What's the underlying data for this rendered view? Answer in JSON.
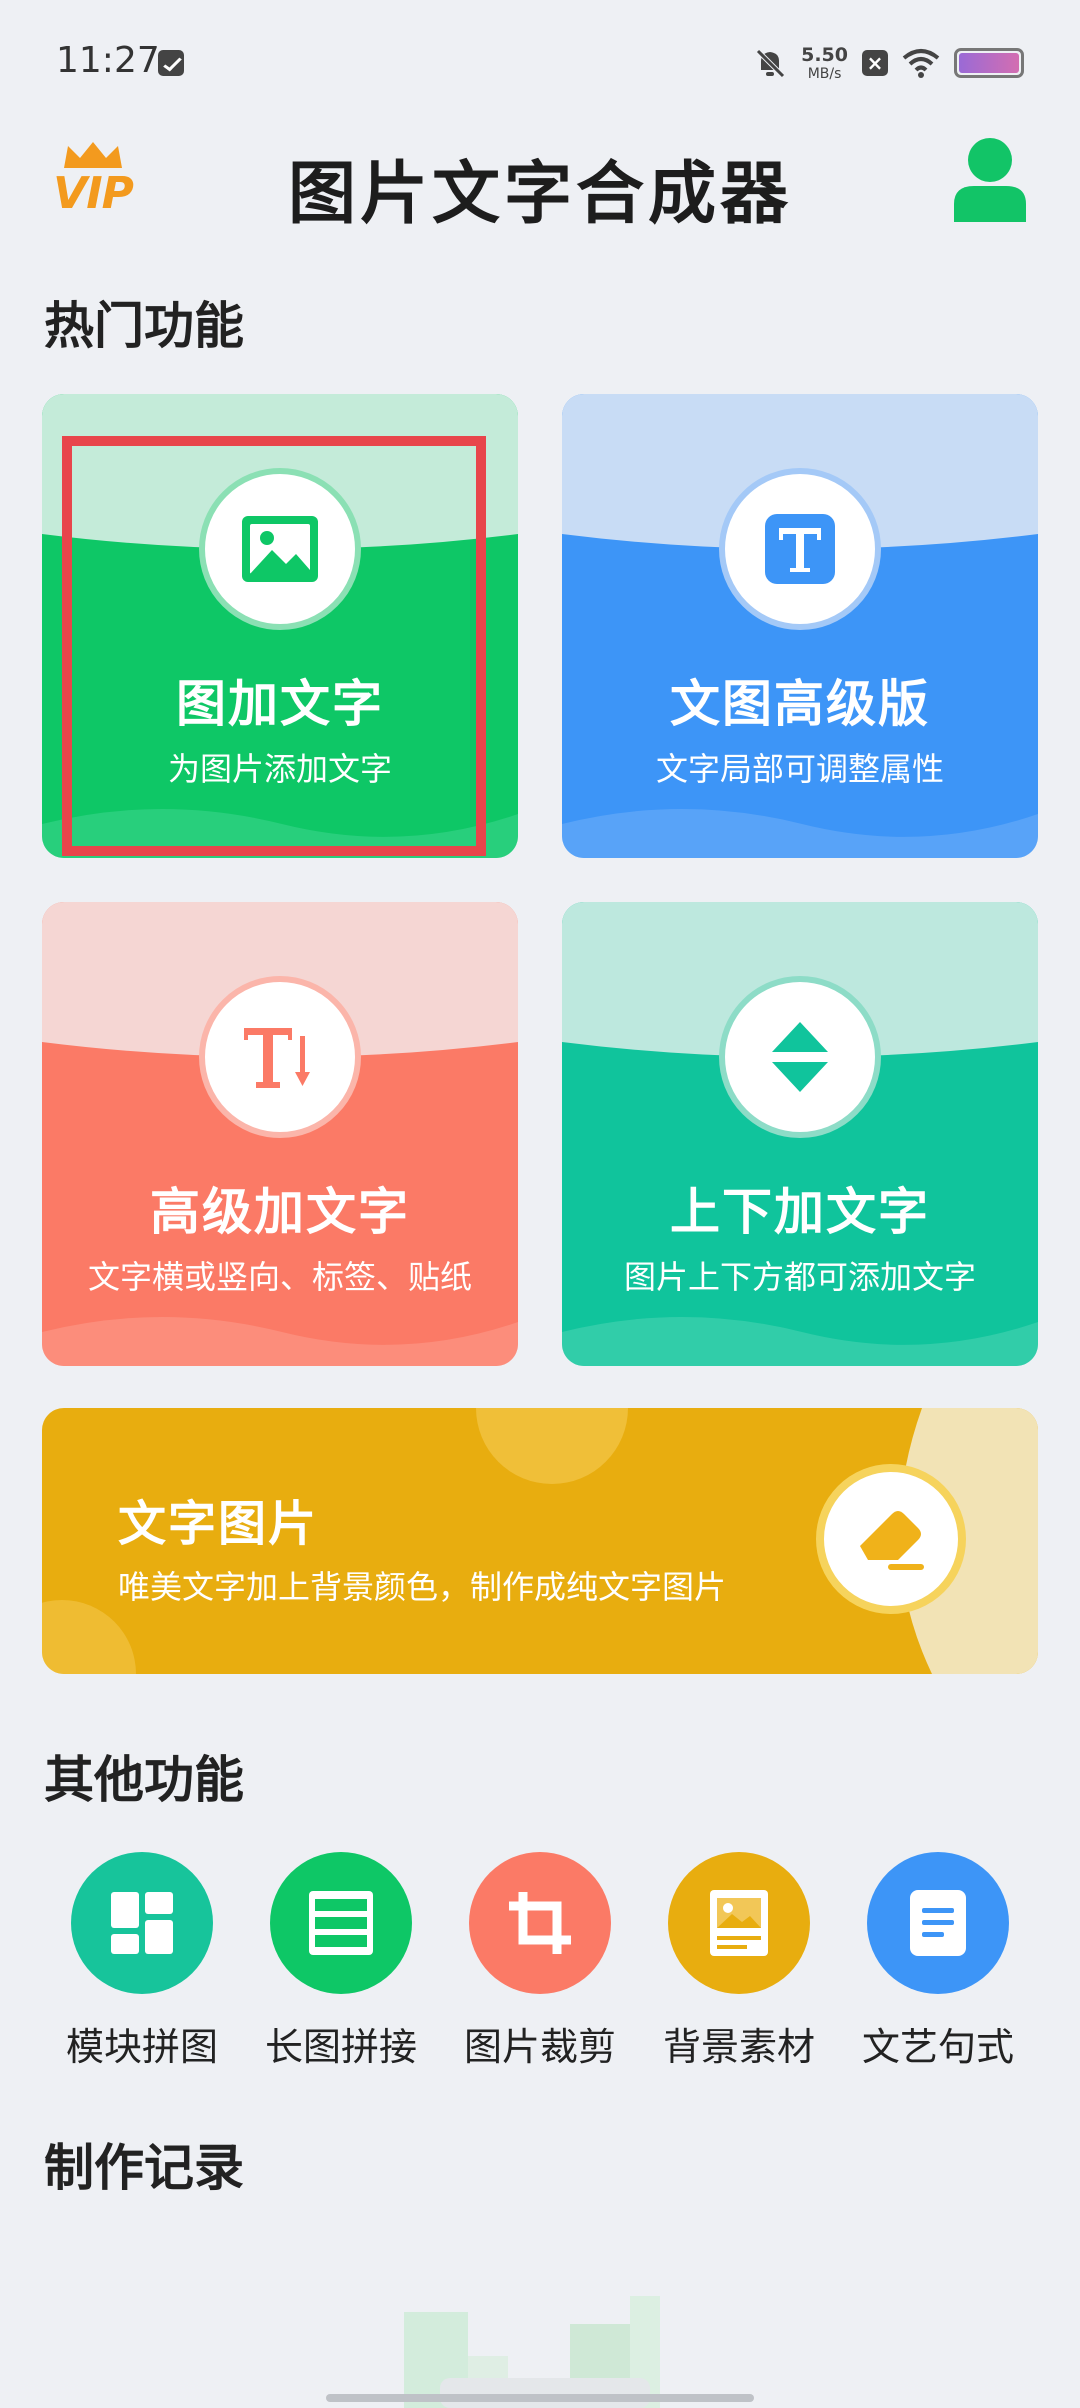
{
  "status_bar": {
    "time": "11:27",
    "net_speed_value": "5.50",
    "net_speed_unit": "MB/s",
    "icons": [
      "message-icon",
      "bell-off-icon",
      "close-box-icon",
      "wifi-icon",
      "battery-icon"
    ]
  },
  "header": {
    "vip_label": "VIP",
    "title": "图片文字合成器",
    "avatar_icon": "user-icon"
  },
  "hot_section": {
    "title": "热门功能",
    "cards": [
      {
        "title": "图加文字",
        "subtitle": "为图片添加文字",
        "icon": "image-icon",
        "color": "#0ec766",
        "light": "#c4ebd9"
      },
      {
        "title": "文图高级版",
        "subtitle": "文字局部可调整属性",
        "icon": "text-t-icon",
        "color": "#3d95f7",
        "light": "#c8dcf5"
      },
      {
        "title": "高级加文字",
        "subtitle": "文字横或竖向、标签、贴纸",
        "icon": "text-vertical-icon",
        "color": "#fb7a66",
        "light": "#f5d6d3"
      },
      {
        "title": "上下加文字",
        "subtitle": "图片上下方都可添加文字",
        "icon": "up-down-arrows-icon",
        "color": "#10c49c",
        "light": "#bde8de"
      }
    ],
    "banner": {
      "title": "文字图片",
      "subtitle": "唯美文字加上背景颜色，制作成纯文字图片",
      "icon": "highlighter-icon",
      "color": "#e8ad0f"
    }
  },
  "other_section": {
    "title": "其他功能",
    "tools": [
      {
        "label": "模块拼图",
        "icon": "grid-layout-icon",
        "color": "#17c49b"
      },
      {
        "label": "长图拼接",
        "icon": "long-image-icon",
        "color": "#0ec766"
      },
      {
        "label": "图片裁剪",
        "icon": "crop-icon",
        "color": "#fb7a66"
      },
      {
        "label": "背景素材",
        "icon": "picture-frame-icon",
        "color": "#e8ad0f"
      },
      {
        "label": "文艺句式",
        "icon": "document-icon",
        "color": "#3d95f7"
      }
    ]
  },
  "records_section": {
    "title": "制作记录"
  }
}
